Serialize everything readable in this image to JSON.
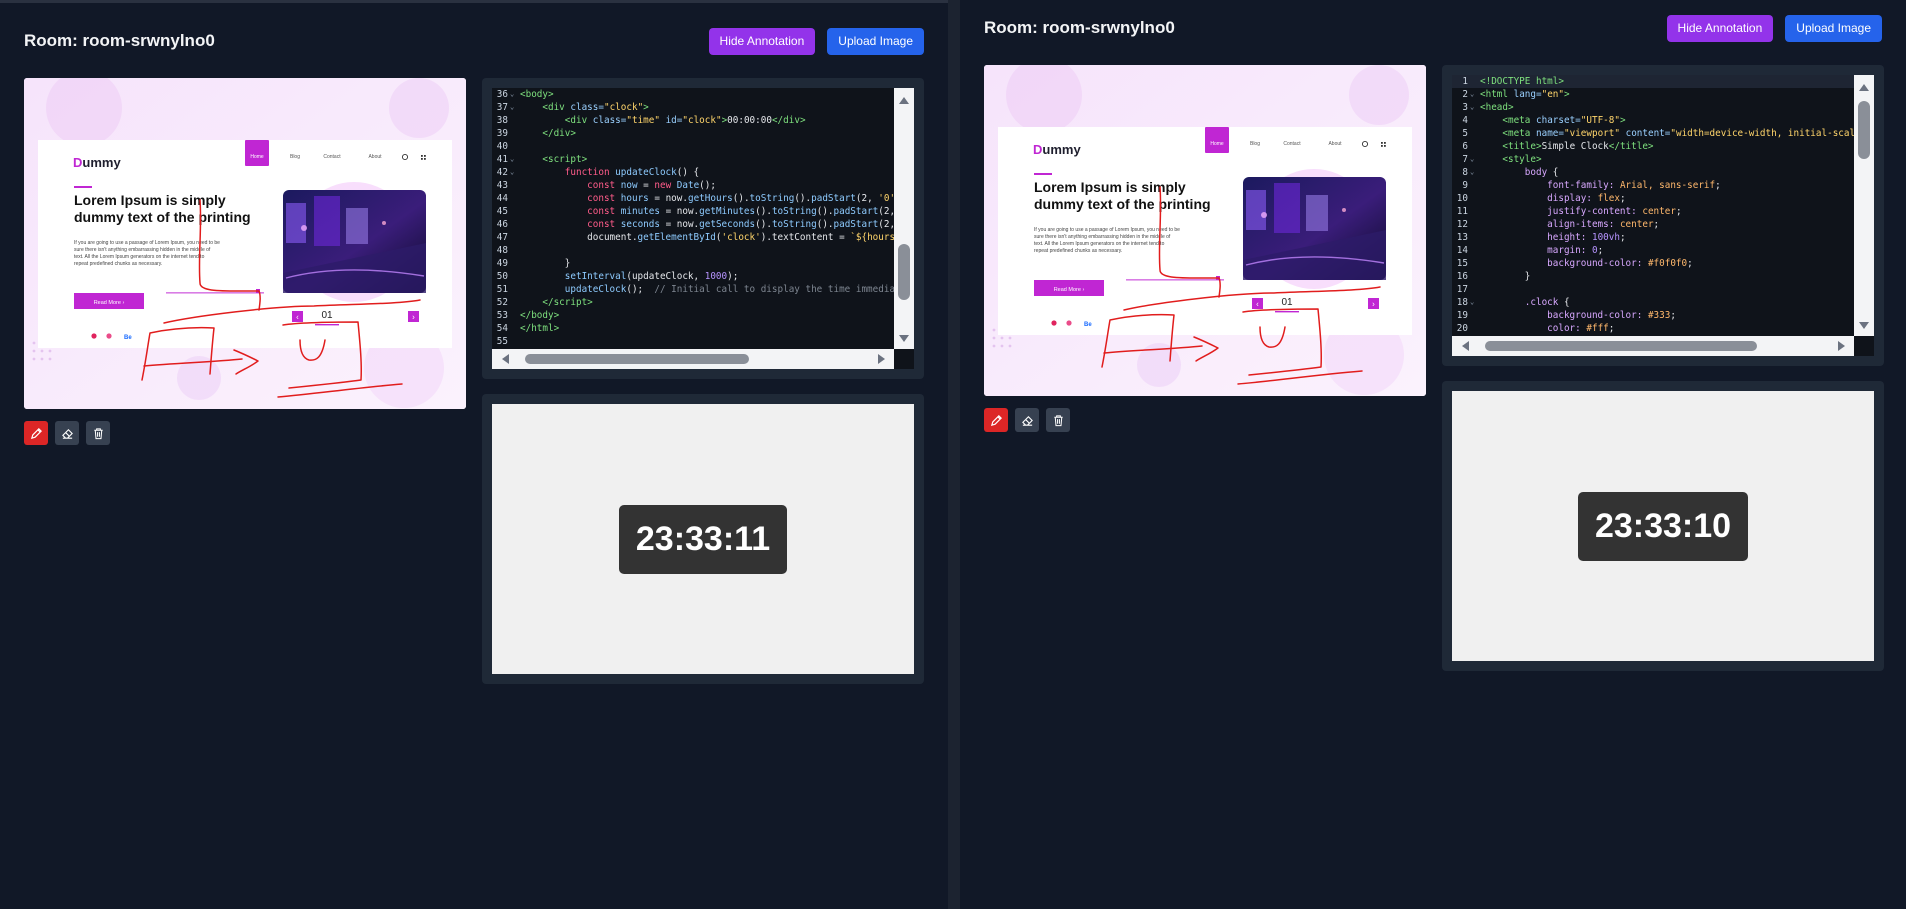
{
  "left": {
    "room_title": "Room: room-srwnylno0",
    "hide_annotation_label": "Hide Annotation",
    "upload_image_label": "Upload Image",
    "clock_time": "23:33:11"
  },
  "right": {
    "room_title": "Room: room-srwnylno0",
    "hide_annotation_label": "Hide Annotation",
    "upload_image_label": "Upload Image",
    "clock_time": "23:33:10"
  },
  "mockup": {
    "logo": "Dummy",
    "nav": [
      "Home",
      "Blog",
      "Contact",
      "About"
    ],
    "headline": "Lorem Ipsum is simply dummy text of the printing",
    "body": "If you are going to use a passage of Lorem Ipsum, you need to be sure there isn't anything embarrassing hidden in the middle of text. All the Lorem Ipsum generators on the internet tend to repeat predefined chunks as necessary.",
    "cta": "Read More",
    "slide_number": "01",
    "social": [
      "p",
      "o",
      "Be"
    ]
  },
  "tools": [
    "pencil-icon",
    "eraser-icon",
    "trash-icon"
  ],
  "colors": {
    "accent_purple": "#9333ea",
    "accent_blue": "#2563eb",
    "annotation_red": "#e11d1d",
    "mockup_magenta": "#c026d3"
  }
}
